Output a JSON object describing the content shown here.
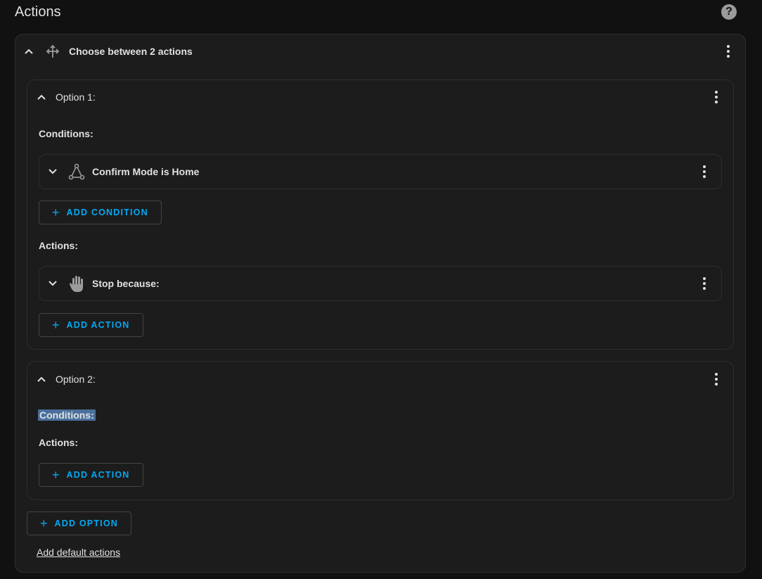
{
  "header": {
    "title": "Actions",
    "help_icon": "help-circle-icon"
  },
  "choose": {
    "title": "Choose between 2 actions",
    "icon": "arrow-decision-icon"
  },
  "option1": {
    "title": "Option 1:",
    "conditions_label": "Conditions:",
    "condition_item": {
      "title": "Confirm Mode is Home",
      "icon": "state-machine-icon"
    },
    "add_condition_label": "ADD CONDITION",
    "actions_label": "Actions:",
    "action_item": {
      "title": "Stop because:",
      "icon": "hand-stop-icon"
    },
    "add_action_label": "ADD ACTION"
  },
  "option2": {
    "title": "Option 2:",
    "conditions_label": "Conditions:",
    "actions_label": "Actions:",
    "add_action_label": "ADD ACTION"
  },
  "footer": {
    "add_option_label": "ADD OPTION",
    "add_default_actions_label": "Add default actions"
  },
  "colors": {
    "accent": "#03a9f4",
    "background": "#111111",
    "card": "#1c1c1c",
    "selection": "#4a6f9c"
  }
}
